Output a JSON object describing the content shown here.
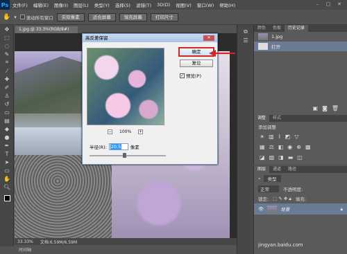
{
  "app": {
    "logo": "Ps"
  },
  "menu": [
    "文件(F)",
    "编辑(E)",
    "图像(I)",
    "图层(L)",
    "类型(Y)",
    "选择(S)",
    "滤镜(T)",
    "3D(D)",
    "视图(V)",
    "窗口(W)",
    "帮助(H)"
  ],
  "window_controls": {
    "minimize": "–",
    "maximize": "▢",
    "close": "✕"
  },
  "options": {
    "scroll_all": "滚动所有窗口",
    "actual_pixels": "实际像素",
    "fit_screen": "适合屏幕",
    "fill_screen": "填充屏幕",
    "print_size": "打印尺寸"
  },
  "document": {
    "tab": "1.jpg @ 33.3%(RGB/8#)",
    "zoom": "33.33%",
    "doc_info": "文档:6.59M/6.59M",
    "timeline": "时间轴"
  },
  "dialog": {
    "title": "高反差保留",
    "close": "✕",
    "ok": "确定",
    "reset": "复位",
    "preview_label": "预览(P)",
    "zoom": "100%",
    "zoom_minus": "−",
    "zoom_plus": "+",
    "radius_label": "半径(R):",
    "radius_value": "20.5",
    "radius_unit": "像素",
    "slider_position": 0.45
  },
  "history_panel": {
    "tabs": [
      "颜色",
      "色板",
      "历史记录"
    ],
    "snapshot": "1.jpg",
    "step": "打开"
  },
  "adjustments_panel": {
    "tabs": [
      "调整",
      "样式"
    ],
    "title": "添加调整"
  },
  "layers_panel": {
    "tabs": [
      "图层",
      "通道",
      "路径"
    ],
    "kind": "类型",
    "blend": "正常",
    "opacity_label": "不透明度:",
    "lock_label": "锁定:",
    "fill_label": "填充:",
    "layer_name": "背景"
  },
  "watermark": "jingyan.baidu.com",
  "colors": {
    "accent_red": "#d42424",
    "ps_blue": "#31a8ff"
  }
}
